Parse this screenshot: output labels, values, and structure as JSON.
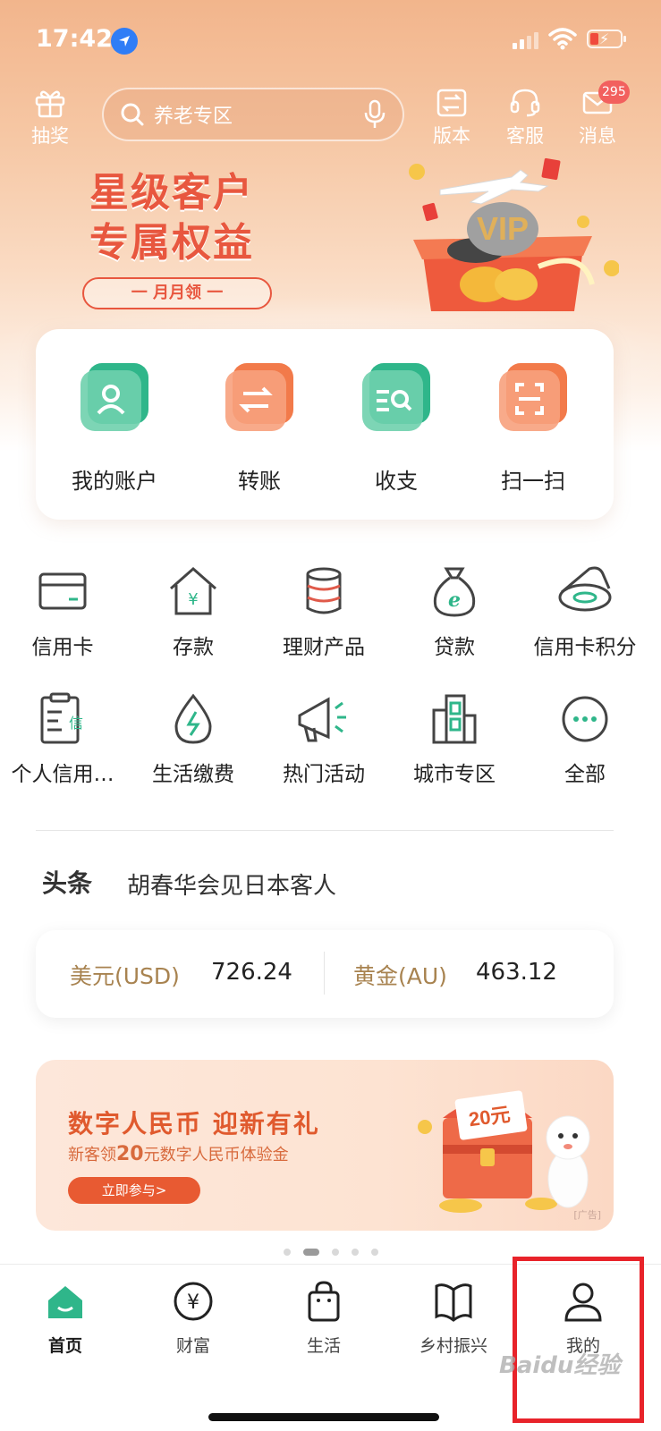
{
  "status_bar": {
    "time": "17:42"
  },
  "top_nav": {
    "lottery_label": "抽奖",
    "search_placeholder": "养老专区",
    "version_label": "版本",
    "service_label": "客服",
    "message_label": "消息",
    "message_badge": "295"
  },
  "banner": {
    "title_line1": "星级客户",
    "title_line2": "专属权益",
    "pill_text": "一 月月领 一",
    "vip_text": "VIP"
  },
  "quick_actions": [
    {
      "label": "我的账户",
      "icon": "account-icon"
    },
    {
      "label": "转账",
      "icon": "transfer-icon"
    },
    {
      "label": "收支",
      "icon": "income-expense-icon"
    },
    {
      "label": "扫一扫",
      "icon": "scan-icon"
    }
  ],
  "services_row1": [
    {
      "label": "信用卡",
      "icon": "credit-card-icon"
    },
    {
      "label": "存款",
      "icon": "deposit-icon"
    },
    {
      "label": "理财产品",
      "icon": "wealth-product-icon"
    },
    {
      "label": "贷款",
      "icon": "loan-icon"
    },
    {
      "label": "信用卡积分",
      "icon": "card-points-icon"
    }
  ],
  "services_row2": [
    {
      "label": "个人信用…",
      "icon": "personal-credit-icon"
    },
    {
      "label": "生活缴费",
      "icon": "utility-payment-icon"
    },
    {
      "label": "热门活动",
      "icon": "hot-activity-icon"
    },
    {
      "label": "城市专区",
      "icon": "city-zone-icon"
    },
    {
      "label": "全部",
      "icon": "more-icon"
    }
  ],
  "credit_icon_char": "信",
  "headline": {
    "tag": "头条",
    "text": "胡春华会见日本客人"
  },
  "rates": {
    "usd_label": "美元(USD)",
    "usd_value": "726.24",
    "gold_label": "黄金(AU)",
    "gold_value": "463.12"
  },
  "ad": {
    "title": "数字人民币 迎新有礼",
    "subtitle_pre": "新客领",
    "subtitle_amount": "20",
    "subtitle_post": "元数字人民币体验金",
    "button": "立即参与>",
    "coupon": "20元",
    "ad_tag": "广告"
  },
  "tabs": [
    {
      "label": "首页",
      "icon": "home-icon",
      "active": true
    },
    {
      "label": "财富",
      "icon": "wealth-icon"
    },
    {
      "label": "生活",
      "icon": "life-bag-icon"
    },
    {
      "label": "乡村振兴",
      "icon": "rural-book-icon"
    },
    {
      "label": "我的",
      "icon": "profile-icon"
    }
  ],
  "watermark": "Baidu经验",
  "colors": {
    "brand_green": "#2fb68a",
    "accent_orange": "#f27a4a",
    "highlight_box": "#e8232a",
    "rate_label": "#a88350"
  }
}
